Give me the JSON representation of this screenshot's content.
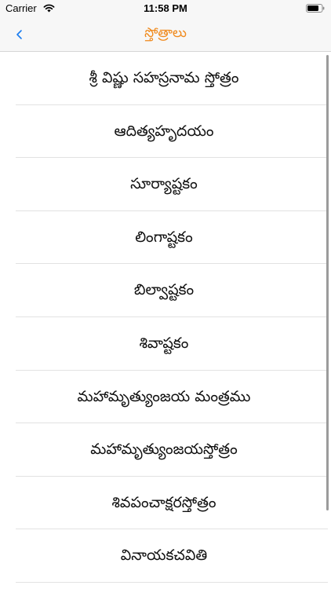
{
  "status_bar": {
    "carrier": "Carrier",
    "time": "11:58 PM",
    "icons": [
      "wifi-icon",
      "battery-icon"
    ]
  },
  "nav": {
    "back_icon": "chevron-left-icon",
    "back_label": "<",
    "title": "స్తోత్రాలు",
    "title_color": "#f08a1d",
    "back_color": "#1a7cf0"
  },
  "list": {
    "items": [
      {
        "label": "శ్రీ విష్ణు సహస్రనామ స్తోత్రం"
      },
      {
        "label": "ఆదిత్యహృదయం"
      },
      {
        "label": "సూర్యాష్టకం"
      },
      {
        "label": "లింగాష్టకం"
      },
      {
        "label": "బిల్వాష్టకం"
      },
      {
        "label": "శివాష్టకం"
      },
      {
        "label": "మహామృత్యుంజయ మంత్రము"
      },
      {
        "label": "మహామృత్యుంజయస్తోత్రం"
      },
      {
        "label": "శివపంచాక్షరస్తోత్రం"
      },
      {
        "label": "వినాయకచవితి"
      }
    ]
  }
}
